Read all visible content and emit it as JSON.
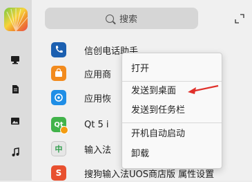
{
  "search": {
    "label": "搜索"
  },
  "sidebar": {
    "items": [
      {
        "name": "computer-icon"
      },
      {
        "name": "document-icon"
      },
      {
        "name": "picture-icon"
      },
      {
        "name": "music-icon"
      }
    ]
  },
  "apps": [
    {
      "label": "信创电话助手",
      "icon": "phone-icon",
      "color": "#1b5fb0"
    },
    {
      "label": "应用商",
      "icon": "app-store-icon",
      "color": "#f28b1e"
    },
    {
      "label": "应用恢",
      "icon": "restore-icon",
      "color": "#1f8ee6"
    },
    {
      "label": "Qt 5 i",
      "icon": "qt-icon",
      "color": "#41b34a"
    },
    {
      "label": "输入法",
      "icon": "keyboard-icon",
      "color": "#d9d9d9"
    },
    {
      "label": "搜狗输入法UOS商店版 属性设置",
      "icon": "sogou-icon",
      "color": "#e8502f"
    }
  ],
  "context_menu": {
    "items": [
      "打开",
      "发送到桌面",
      "发送到任务栏",
      "开机自动启动",
      "卸载"
    ]
  },
  "colors": {
    "annotation_arrow": "#e0302a"
  }
}
